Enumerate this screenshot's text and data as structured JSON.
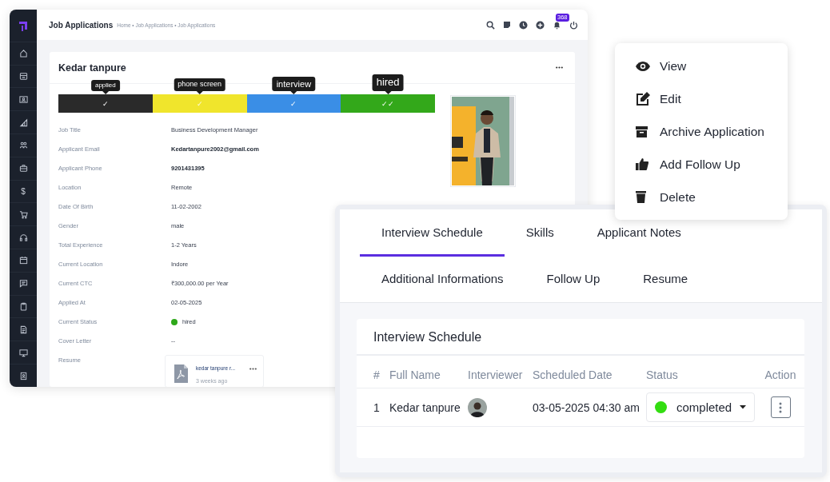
{
  "app": {
    "title": "Job Applications",
    "breadcrumb": "Home • Job Applications • Job Applications",
    "notification_count": "368",
    "currency_symbol": "$"
  },
  "applicant": {
    "name": "Kedar tanpure",
    "stages": [
      {
        "label": "applied",
        "mark": "✓",
        "color": "#2a2a2a"
      },
      {
        "label": "phone screen",
        "mark": "✓",
        "color": "#f0e52c"
      },
      {
        "label": "interview",
        "mark": "✓",
        "color": "#3a8ee6"
      },
      {
        "label": "hired",
        "mark": "✓✓",
        "color": "#33a81a"
      }
    ],
    "fields": [
      {
        "kind": "plain",
        "label": "Job Title",
        "value": "Business Development Manager"
      },
      {
        "kind": "strong",
        "label": "Applicant Email",
        "value": "Kedartanpure2002@gmail.com"
      },
      {
        "kind": "strong",
        "label": "Applicant Phone",
        "value": "9201431395"
      },
      {
        "kind": "plain",
        "label": "Location",
        "value": "Remote"
      },
      {
        "kind": "plain",
        "label": "Date Of Birth",
        "value": "11-02-2002"
      },
      {
        "kind": "plain",
        "label": "Gender",
        "value": "male"
      },
      {
        "kind": "plain",
        "label": "Total Experience",
        "value": "1-2 Years"
      },
      {
        "kind": "plain",
        "label": "Current Location",
        "value": "Indore"
      },
      {
        "kind": "plain",
        "label": "Current CTC",
        "value": "₹300,000.00 per Year"
      },
      {
        "kind": "plain",
        "label": "Applied At",
        "value": "02-05-2025"
      },
      {
        "kind": "status",
        "label": "Current Status",
        "value": "hired",
        "color": "#2ea81a"
      },
      {
        "kind": "plain",
        "label": "Cover Letter",
        "value": "--"
      },
      {
        "kind": "file",
        "label": "Resume",
        "value": "kedar tanpure r...",
        "time": "3 weeks ago"
      }
    ]
  },
  "menu": [
    {
      "label": "View"
    },
    {
      "label": "Edit"
    },
    {
      "label": "Archive Application"
    },
    {
      "label": "Add Follow Up"
    },
    {
      "label": "Delete"
    }
  ],
  "tabs": [
    [
      {
        "label": "Interview Schedule",
        "selected": true
      },
      {
        "label": "Skills",
        "selected": false
      },
      {
        "label": "Applicant Notes",
        "selected": false
      }
    ],
    [
      {
        "label": "Additional Informations",
        "selected": false
      },
      {
        "label": "Follow Up",
        "selected": false
      },
      {
        "label": "Resume",
        "selected": false
      }
    ]
  ],
  "schedule": {
    "title": "Interview Schedule",
    "columns": [
      "#",
      "Full Name",
      "Interviewer",
      "Scheduled Date",
      "Status",
      "Action"
    ],
    "rows": [
      {
        "index": "1",
        "name": "Kedar tanpure",
        "date": "03-05-2025 04:30 am",
        "status": "completed",
        "color": "#33dd11"
      }
    ]
  }
}
